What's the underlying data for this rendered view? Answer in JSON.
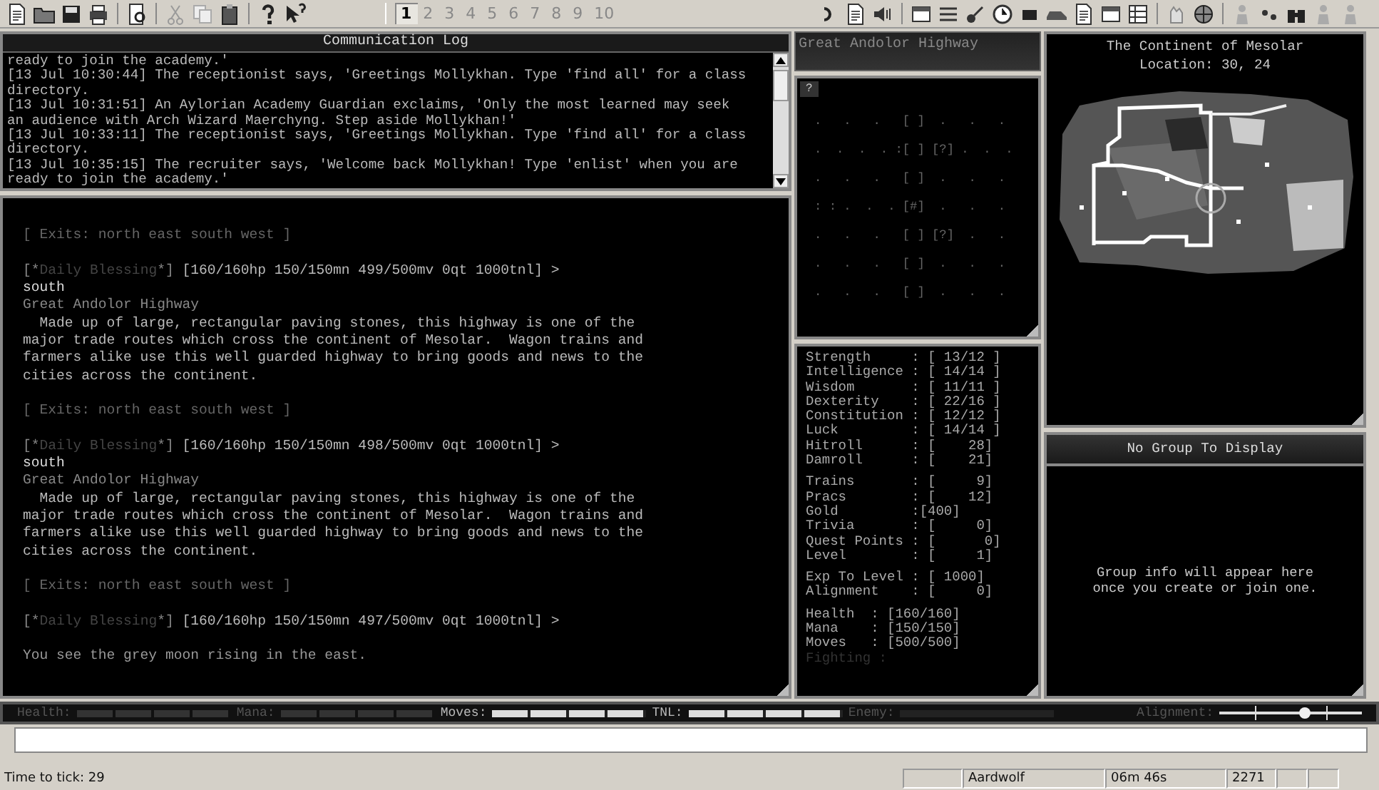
{
  "toolbar": {
    "tabs": [
      {
        "label": "1",
        "selected": true
      },
      {
        "label": "2",
        "selected": false
      },
      {
        "label": "3",
        "selected": false
      },
      {
        "label": "4",
        "selected": false
      },
      {
        "label": "5",
        "selected": false
      },
      {
        "label": "6",
        "selected": false
      },
      {
        "label": "7",
        "selected": false
      },
      {
        "label": "8",
        "selected": false
      },
      {
        "label": "9",
        "selected": false
      },
      {
        "label": "10",
        "selected": false
      }
    ]
  },
  "comm_log": {
    "title": "Communication Log",
    "lines": [
      "ready to join the academy.'",
      "[13 Jul 10:30:44] The receptionist says, 'Greetings Mollykhan. Type 'find all' for a class",
      "directory.",
      "[13 Jul 10:31:51] An Aylorian Academy Guardian exclaims, 'Only the most learned may seek",
      "an audience with Arch Wizard Maerchyng. Step aside Mollykhan!'",
      "[13 Jul 10:33:11] The receptionist says, 'Greetings Mollykhan. Type 'find all' for a class",
      "directory.",
      "[13 Jul 10:35:15] The recruiter says, 'Welcome back Mollykhan! Type 'enlist' when you are",
      "ready to join the academy.'"
    ]
  },
  "main_output": {
    "lines": [
      {
        "kind": "exits",
        "text": "[ Exits: north east south west ]",
        "gap_before": true
      },
      {
        "kind": "prompt",
        "open": "[*",
        "tag": "Daily Blessing",
        "close": "*]",
        "text": " [160/160hp 150/150mn 499/500mv 0qt 1000tnl] >",
        "gap_before": true
      },
      {
        "kind": "command",
        "text": "south",
        "gap_before": false
      },
      {
        "kind": "room",
        "text": "Great Andolor Highway",
        "gap_before": false
      },
      {
        "kind": "desc",
        "text": "  Made up of large, rectangular paving stones, this highway is one of the\nmajor trade routes which cross the continent of Mesolar.  Wagon trains and\nfarmers alike use this well guarded highway to bring goods and news to the\ncities across the continent.",
        "gap_before": false
      },
      {
        "kind": "exits",
        "text": "[ Exits: north east south west ]",
        "gap_before": true
      },
      {
        "kind": "prompt",
        "open": "[*",
        "tag": "Daily Blessing",
        "close": "*]",
        "text": " [160/160hp 150/150mn 498/500mv 0qt 1000tnl] >",
        "gap_before": true
      },
      {
        "kind": "command",
        "text": "south",
        "gap_before": false
      },
      {
        "kind": "room",
        "text": "Great Andolor Highway",
        "gap_before": false
      },
      {
        "kind": "desc",
        "text": "  Made up of large, rectangular paving stones, this highway is one of the\nmajor trade routes which cross the continent of Mesolar.  Wagon trains and\nfarmers alike use this well guarded highway to bring goods and news to the\ncities across the continent.",
        "gap_before": false
      },
      {
        "kind": "exits",
        "text": "[ Exits: north east south west ]",
        "gap_before": true
      },
      {
        "kind": "prompt",
        "open": "[*",
        "tag": "Daily Blessing",
        "close": "*]",
        "text": " [160/160hp 150/150mn 497/500mv 0qt 1000tnl] >",
        "gap_before": true
      },
      {
        "kind": "plain",
        "text": "You see the grey moon rising in the east.",
        "gap_before": true
      }
    ]
  },
  "room_panel": {
    "title": "Great Andolor Highway",
    "badge": "?",
    "rows": [
      ".   .   .   [ ]  .   .   .",
      ".  .  .  . :[ ] [?] .  .  .",
      ".   .   .   [ ]  .   .   .",
      ": : .  .  . [#]  .   .   .",
      ".   .   .   [ ] [?]  .   .",
      ".   .   .   [ ]  .   .   .",
      ".   .   .   [ ]  .   .   ."
    ]
  },
  "world_map": {
    "title": "The Continent of Mesolar",
    "location": "Location: 30, 24"
  },
  "stats": {
    "groups": [
      {
        "rows": [
          {
            "text": "Strength     : [ 13/12 ]",
            "dim": false
          },
          {
            "text": "Intelligence : [ 14/14 ]",
            "dim": false
          },
          {
            "text": "Wisdom       : [ 11/11 ]",
            "dim": false
          },
          {
            "text": "Dexterity    : [ 22/16 ]",
            "dim": false
          },
          {
            "text": "Constitution : [ 12/12 ]",
            "dim": false
          },
          {
            "text": "Luck         : [ 14/14 ]",
            "dim": false
          },
          {
            "text": "Hitroll      : [    28]",
            "dim": false
          },
          {
            "text": "Damroll      : [    21]",
            "dim": false
          }
        ]
      },
      {
        "rows": [
          {
            "text": "Trains       : [     9]",
            "dim": false
          },
          {
            "text": "Pracs        : [    12]",
            "dim": false
          },
          {
            "text": "Gold         :[400]",
            "dim": false
          },
          {
            "text": "Trivia       : [     0]",
            "dim": false
          },
          {
            "text": "Quest Points : [      0]",
            "dim": false
          },
          {
            "text": "Level        : [     1]",
            "dim": false
          }
        ]
      },
      {
        "rows": [
          {
            "text": "Exp To Level : [ 1000]",
            "dim": false
          },
          {
            "text": "Alignment    : [     0]",
            "dim": false
          }
        ]
      },
      {
        "rows": [
          {
            "text": "Health  : [160/160]",
            "dim": false
          },
          {
            "text": "Mana    : [150/150]",
            "dim": false
          },
          {
            "text": "Moves   : [500/500]",
            "dim": false
          },
          {
            "text": "Fighting :",
            "dim": true
          }
        ]
      }
    ]
  },
  "group_panel": {
    "title": "No Group To Display",
    "message": "Group info will appear here\nonce you create or join one."
  },
  "gauges": [
    {
      "label": "Health:",
      "level": 1,
      "dim": true
    },
    {
      "label": "Mana:",
      "level": 1,
      "dim": true
    },
    {
      "label": "Moves:",
      "level": 1,
      "dim": false
    },
    {
      "label": "TNL:",
      "level": 1,
      "dim": false
    },
    {
      "label": "Enemy:",
      "dim": true
    }
  ],
  "alignment": {
    "label": "Alignment:",
    "level": 0.6
  },
  "status_bar": {
    "tick": "Time to tick: 29",
    "cells": [
      "Aardwolf",
      "06m 46s",
      "2271"
    ]
  }
}
